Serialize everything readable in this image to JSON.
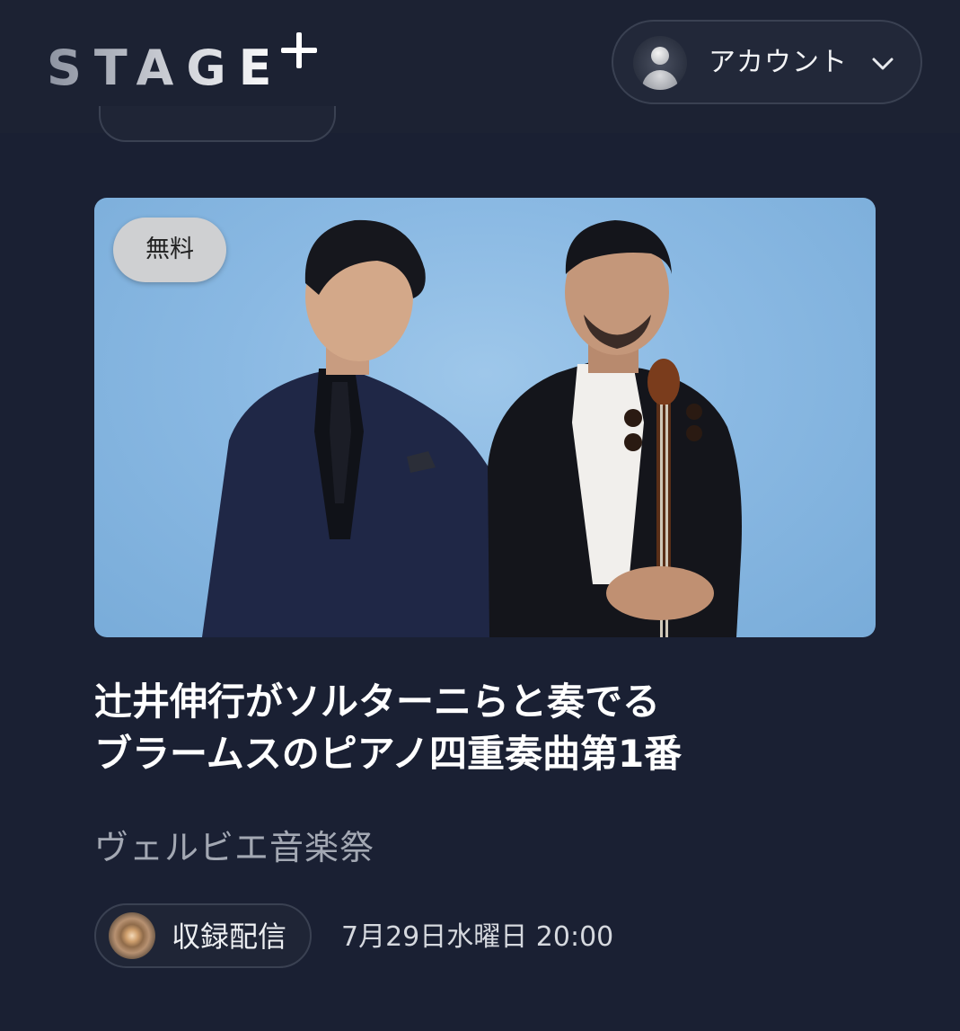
{
  "header": {
    "logo_text": "STAGE",
    "account_label": "アカウント"
  },
  "card": {
    "badge": "無料",
    "title_line1": "辻井伸行がソルターニらと奏でる",
    "title_line2": "ブラームスのピアノ四重奏曲第1番",
    "subtitle": "ヴェルビエ音楽祭",
    "stream_type": "収録配信",
    "datetime": "7月29日水曜日 20:00"
  },
  "colors": {
    "background": "#1a2033",
    "image_backdrop": "#8ab9e3",
    "badge_bg": "#cfd0d2"
  },
  "icons": {
    "logo_plus": "plus-icon",
    "avatar": "user-avatar-icon",
    "chevron": "chevron-down-icon",
    "record": "recording-icon"
  }
}
